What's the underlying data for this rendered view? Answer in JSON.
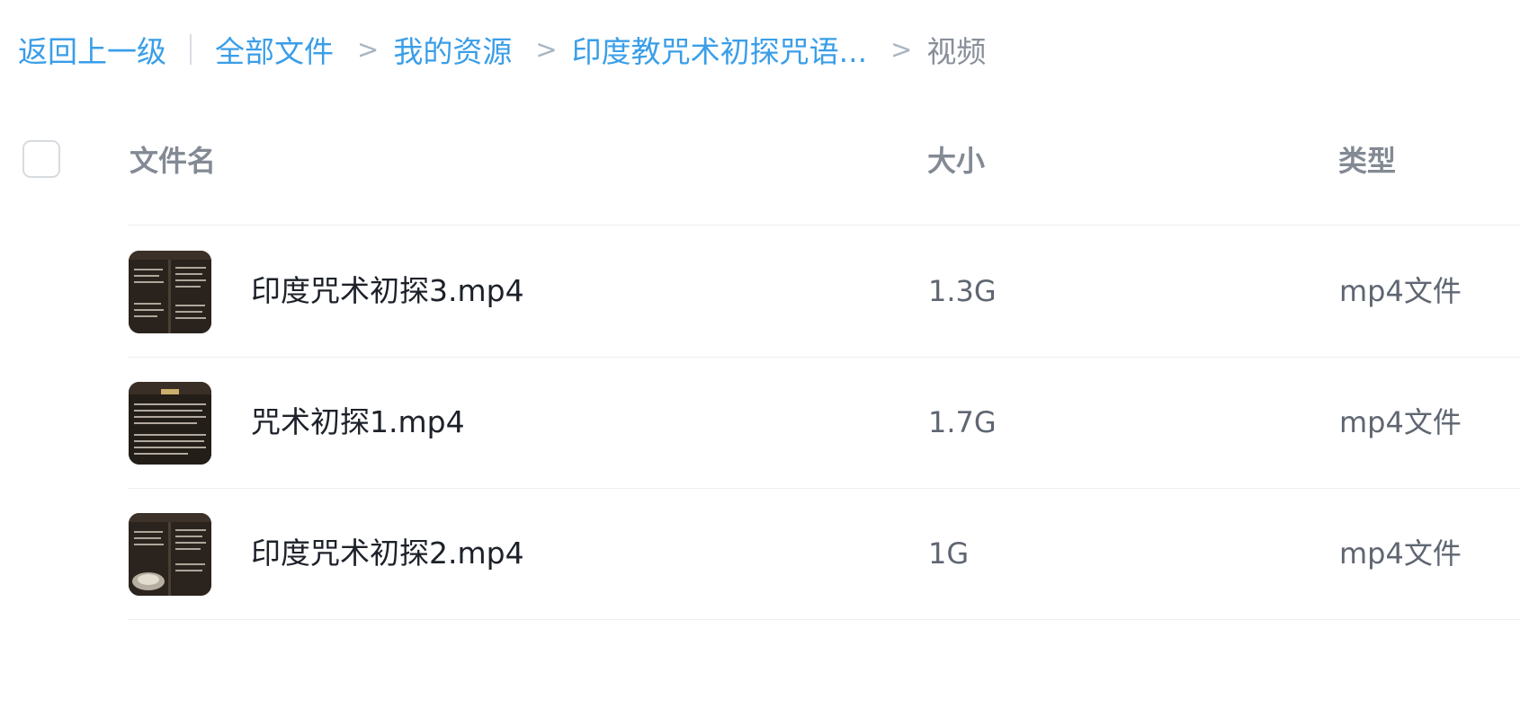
{
  "breadcrumb": {
    "back_label": "返回上一级",
    "items": [
      "全部文件",
      "我的资源",
      "印度教咒术初探咒语..."
    ],
    "current": "视频",
    "separator": ">"
  },
  "table": {
    "columns": {
      "name": "文件名",
      "size": "大小",
      "type": "类型"
    },
    "rows": [
      {
        "name": "印度咒术初探3.mp4",
        "size": "1.3G",
        "type": "mp4文件",
        "thumbnail": "video-thumbnail"
      },
      {
        "name": "咒术初探1.mp4",
        "size": "1.7G",
        "type": "mp4文件",
        "thumbnail": "video-thumbnail"
      },
      {
        "name": "印度咒术初探2.mp4",
        "size": "1G",
        "type": "mp4文件",
        "thumbnail": "video-thumbnail"
      }
    ]
  },
  "colors": {
    "link": "#3a9ee8",
    "header_text": "#838a94",
    "file_name": "#1d2129",
    "meta_text": "#5f6672",
    "divider": "#eceff2"
  }
}
